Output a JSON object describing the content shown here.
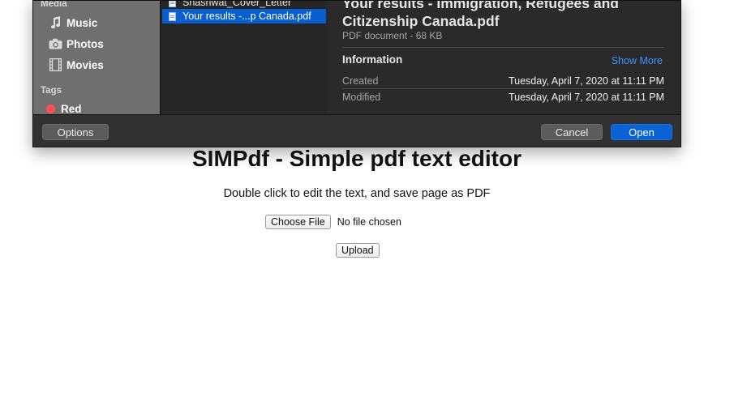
{
  "dialog": {
    "sidebar": {
      "media_header": "Media",
      "items": [
        {
          "label": "Music",
          "icon": "music-note-icon"
        },
        {
          "label": "Photos",
          "icon": "camera-icon"
        },
        {
          "label": "Movies",
          "icon": "film-icon"
        }
      ],
      "tags_header": "Tags",
      "tags": [
        {
          "label": "Red",
          "color": "#ff4f4f"
        }
      ]
    },
    "files": [
      {
        "name": "Shashwat_Cover_Letter",
        "selected": false
      },
      {
        "name": "Your results -...p Canada.pdf",
        "selected": true
      }
    ],
    "preview": {
      "title": "Your results - Immigration, Refugees and Citizenship Canada.pdf",
      "meta": "PDF document - 68 KB",
      "info_header": "Information",
      "show_more": "Show More",
      "rows": [
        {
          "label": "Created",
          "value": "Tuesday, April 7, 2020 at 11:11 PM"
        },
        {
          "label": "Modified",
          "value": "Tuesday, April 7, 2020 at 11:11 PM"
        }
      ]
    },
    "footer": {
      "options_label": "Options",
      "cancel_label": "Cancel",
      "open_label": "Open"
    }
  },
  "page": {
    "title": "SIMPdf - Simple pdf text editor",
    "subtitle": "Double click to edit the text, and save page as PDF",
    "choose_file_label": "Choose File",
    "file_status": "No file chosen",
    "upload_label": "Upload"
  },
  "colors": {
    "accent": "#0a63d6",
    "link": "#3b95ff"
  }
}
